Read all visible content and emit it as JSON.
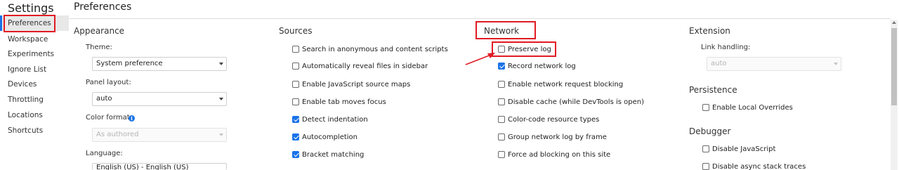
{
  "sidebar": {
    "title": "Settings",
    "items": [
      {
        "label": "Preferences"
      },
      {
        "label": "Workspace"
      },
      {
        "label": "Experiments"
      },
      {
        "label": "Ignore List"
      },
      {
        "label": "Devices"
      },
      {
        "label": "Throttling"
      },
      {
        "label": "Locations"
      },
      {
        "label": "Shortcuts"
      }
    ],
    "active_index": 0
  },
  "main": {
    "title": "Preferences",
    "appearance": {
      "title": "Appearance",
      "theme": {
        "label": "Theme:",
        "value": "System preference"
      },
      "panel_layout": {
        "label": "Panel layout:",
        "value": "auto"
      },
      "color_format": {
        "label": "Color format:",
        "value": "As authored"
      },
      "language": {
        "label": "Language:",
        "value": "English (US) - English (US)"
      }
    },
    "sources": {
      "title": "Sources",
      "options": [
        {
          "label": "Search in anonymous and content scripts",
          "checked": false
        },
        {
          "label": "Automatically reveal files in sidebar",
          "checked": false
        },
        {
          "label": "Enable JavaScript source maps",
          "checked": false
        },
        {
          "label": "Enable tab moves focus",
          "checked": false
        },
        {
          "label": "Detect indentation",
          "checked": true
        },
        {
          "label": "Autocompletion",
          "checked": true
        },
        {
          "label": "Bracket matching",
          "checked": true
        }
      ]
    },
    "network": {
      "title": "Network",
      "options": [
        {
          "label": "Preserve log",
          "checked": false
        },
        {
          "label": "Record network log",
          "checked": true
        },
        {
          "label": "Enable network request blocking",
          "checked": false
        },
        {
          "label": "Disable cache (while DevTools is open)",
          "checked": false
        },
        {
          "label": "Color-code resource types",
          "checked": false
        },
        {
          "label": "Group network log by frame",
          "checked": false
        },
        {
          "label": "Force ad blocking on this site",
          "checked": false
        }
      ]
    },
    "extension": {
      "title": "Extension",
      "link_handling": {
        "label": "Link handling:",
        "value": "auto"
      }
    },
    "persistence": {
      "title": "Persistence",
      "options": [
        {
          "label": "Enable Local Overrides",
          "checked": false
        }
      ]
    },
    "debugger": {
      "title": "Debugger",
      "options": [
        {
          "label": "Disable JavaScript",
          "checked": false
        },
        {
          "label": "Disable async stack traces",
          "checked": false
        }
      ]
    }
  },
  "colors": {
    "accent": "#1a73e8",
    "annotation_red": "#e01b24"
  }
}
